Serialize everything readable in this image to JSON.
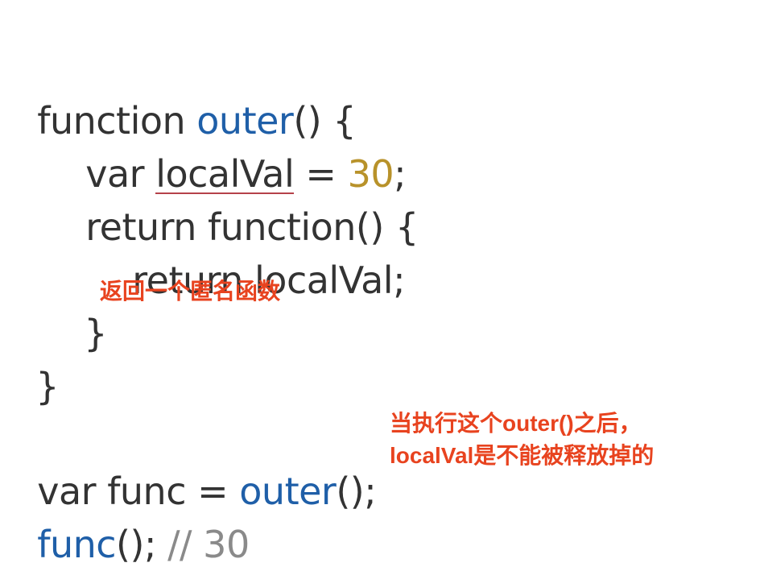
{
  "code": {
    "line1": {
      "kw": "function ",
      "name": "outer",
      "rest": "() {"
    },
    "line2": {
      "kw": "var ",
      "var": "localVal",
      "eq": " = ",
      "num": "30",
      "end": ";"
    },
    "line3": {
      "text": "return function() {"
    },
    "line4": {
      "text": "return localVal;"
    },
    "line5": {
      "text": "}"
    },
    "line6": {
      "text": "}"
    },
    "line7": {
      "pre": "var func = ",
      "call": "outer",
      "post": "();"
    },
    "line8": {
      "call": "func",
      "post": "(); ",
      "comment": "// 30"
    }
  },
  "annotations": {
    "inner_function_note": "返回一个匿名函数",
    "outer_call_note_line1": "当执行这个outer()之后，",
    "outer_call_note_line2": "localVal是不能被释放掉的"
  },
  "colors": {
    "text": "#333333",
    "identifier_blue": "#1f5fa8",
    "number_gold": "#b8922a",
    "comment_gray": "#8a8a8a",
    "annotation_red": "#e8431f",
    "squiggle_red": "#b5414a"
  }
}
